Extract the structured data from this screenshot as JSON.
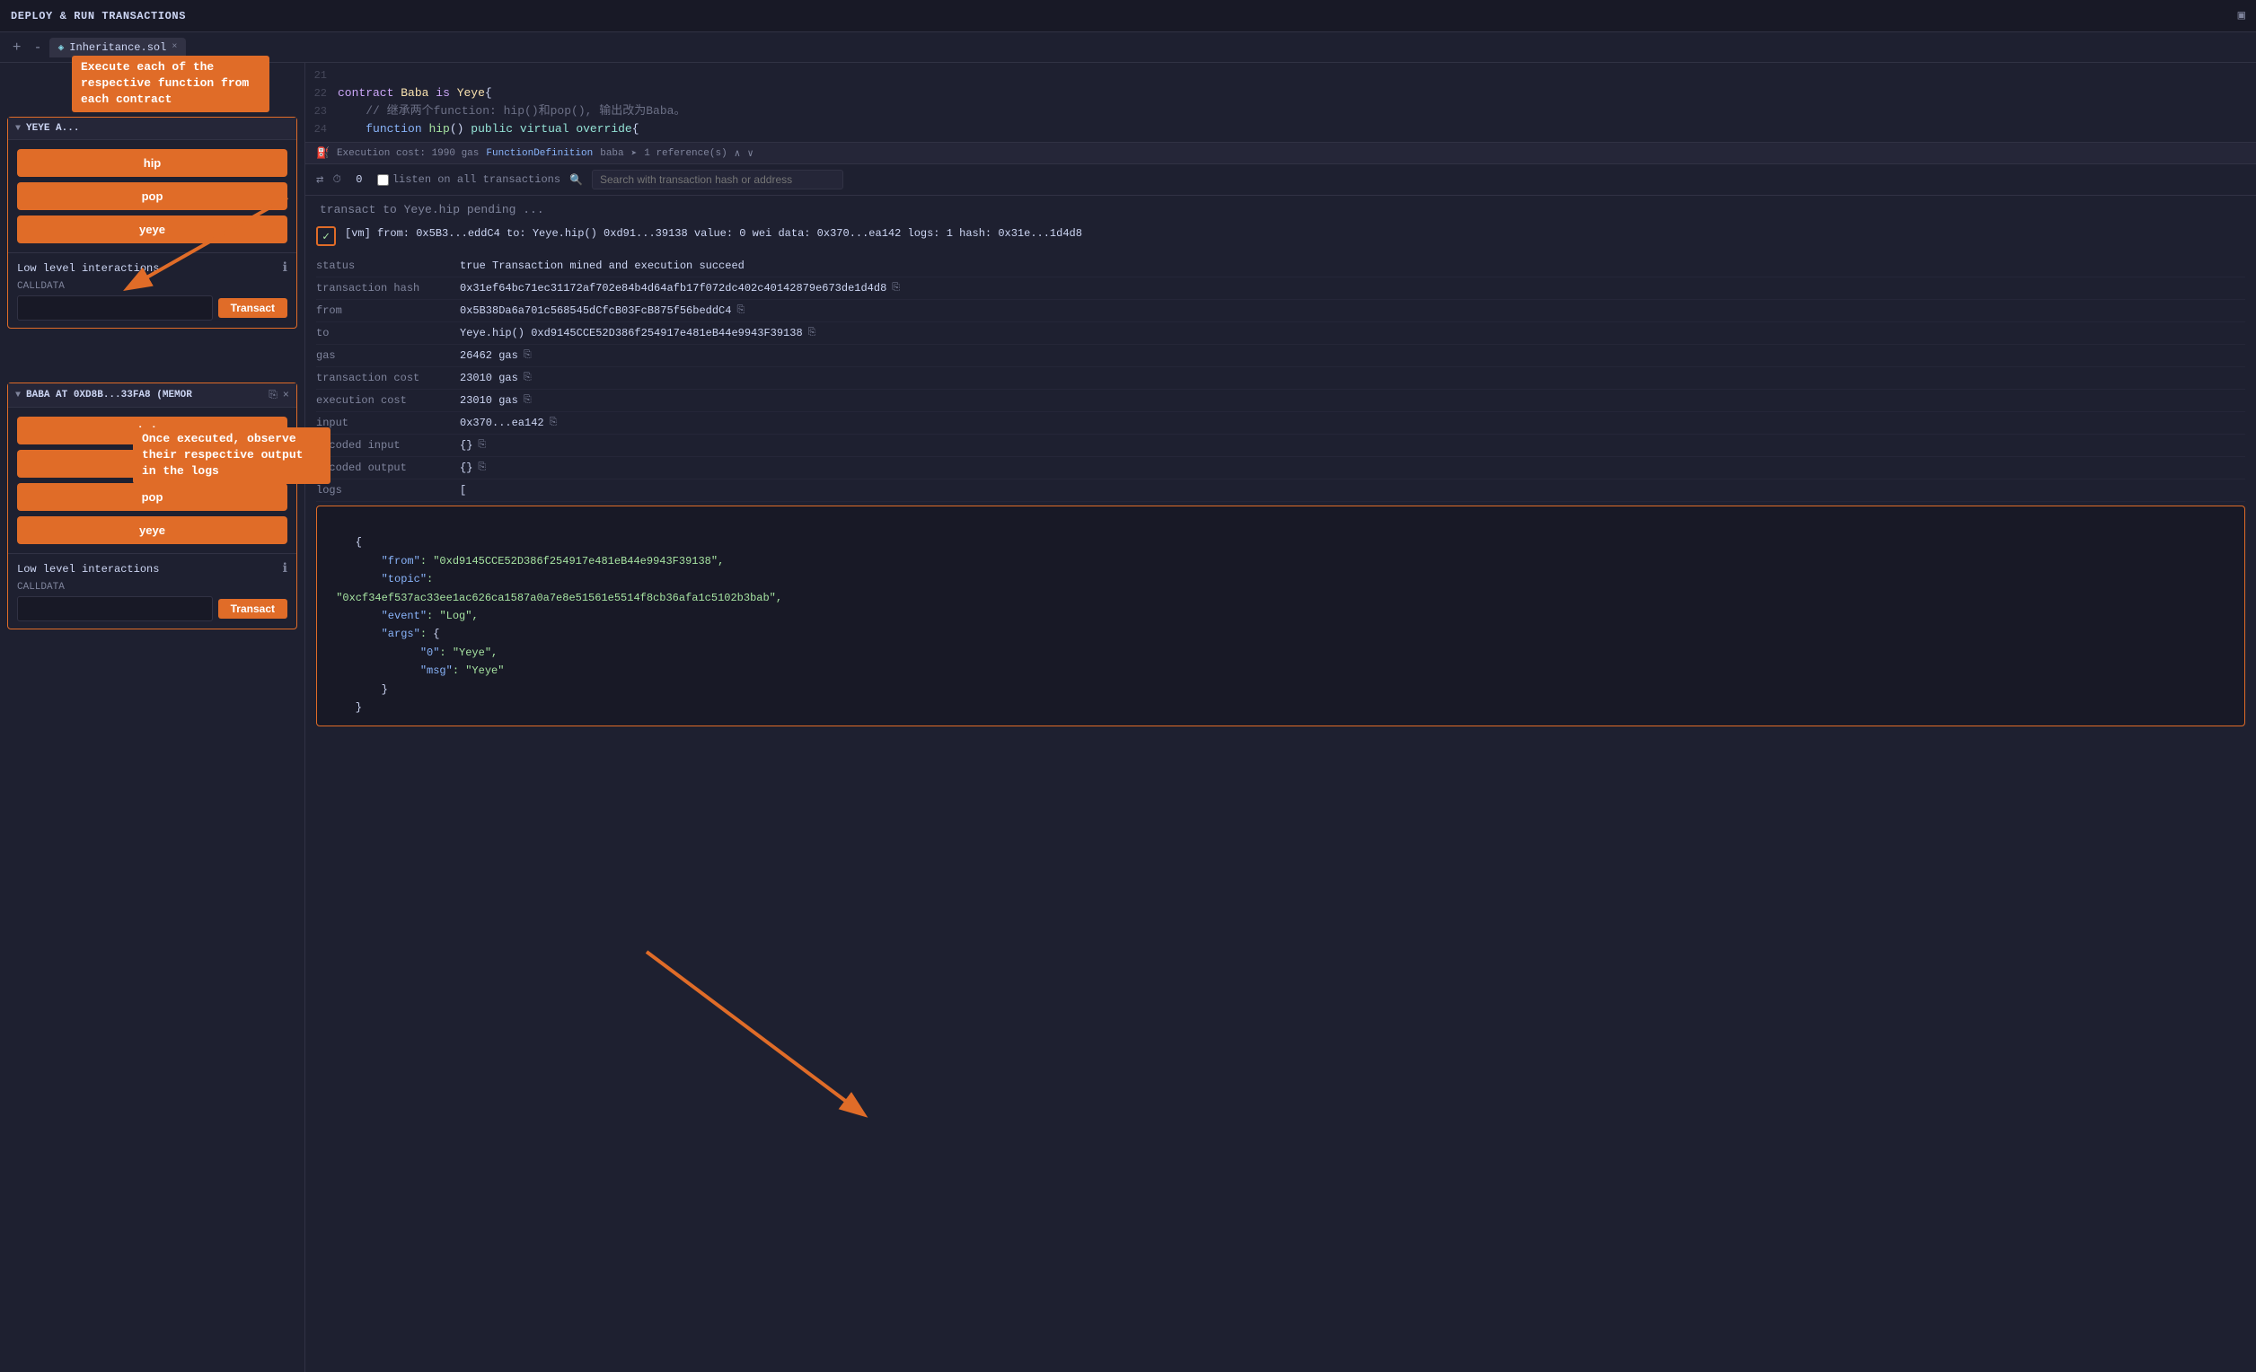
{
  "topbar": {
    "title": "DEPLOY & RUN TRANSACTIONS",
    "icon": "panel-icon"
  },
  "tabs": {
    "zoom_in": "+",
    "zoom_out": "-",
    "tab_label": "Inheritance.sol",
    "close": "×"
  },
  "code": {
    "lines": [
      {
        "num": "21",
        "content": ""
      },
      {
        "num": "22",
        "content": "contract Baba is Yeye{"
      },
      {
        "num": "23",
        "content": "    // 继承两个function: hip()和pop(), 输出改为Baba。"
      },
      {
        "num": "24",
        "content": "    function hip() public virtual override{"
      }
    ]
  },
  "exec_bar": {
    "icon": "⛽",
    "label": "Execution cost: 1990 gas",
    "func_type": "FunctionDefinition",
    "func_name": "baba",
    "refs": "1 reference(s)",
    "arrow_up": "∧",
    "arrow_down": "∨"
  },
  "tx_bar": {
    "counter": "0",
    "listen_label": "listen on all transactions",
    "search_placeholder": "Search with transaction hash or address"
  },
  "log_pending": "transact to Yeye.hip pending ...",
  "log_entry": {
    "summary": "[vm] from: 0x5B3...eddC4 to: Yeye.hip() 0xd91...39138 value: 0 wei data: 0x370...ea142 logs: 1 hash: 0x31e...1d4d8",
    "rows": [
      {
        "key": "status",
        "value": "true Transaction mined and execution succeed"
      },
      {
        "key": "transaction hash",
        "value": "0x31ef64bc71ec31172af702e84b4d64afb17f072dc402c40142879e673de1d4d8",
        "copy": true
      },
      {
        "key": "from",
        "value": "0x5B38Da6a701c568545dCfcB03FcB875f56beddC4",
        "copy": true
      },
      {
        "key": "to",
        "value": "Yeye.hip() 0xd9145CCE52D386f254917e481eB44e9943F39138",
        "copy": true
      },
      {
        "key": "gas",
        "value": "26462 gas",
        "copy": true
      },
      {
        "key": "transaction cost",
        "value": "23010 gas",
        "copy": true
      },
      {
        "key": "execution cost",
        "value": "23010 gas",
        "copy": true
      },
      {
        "key": "input",
        "value": "0x370...ea142",
        "copy": true
      },
      {
        "key": "decoded input",
        "value": "{}",
        "copy": true
      },
      {
        "key": "decoded output",
        "value": "{}",
        "copy": true
      },
      {
        "key": "logs",
        "value": "["
      }
    ],
    "logs_json": "    {\n        \"from\": \"0xd9145CCE52D386f254917e481eB44e9943F39138\",\n        \"topic\":\n \"0xcf34ef537ac33ee1ac626ca1587a0a7e8e51561e5514f8cb36afa1c5102b3bab\",\n        \"event\": \"Log\",\n        \"args\": {\n              \"0\": \"Yeye\",\n              \"msg\": \"Yeye\"\n        }\n    }"
  },
  "sidebar": {
    "yeye_section": {
      "header": "YEYE A...",
      "buttons": [
        "hip",
        "pop",
        "yeye"
      ]
    },
    "baba_section": {
      "header": "BABA AT 0XD8B...33FA8 (MEMOR",
      "buttons": [
        "baba",
        "hip",
        "pop",
        "yeye"
      ]
    },
    "low_level_label": "Low level interactions",
    "calldata_label": "CALLDATA",
    "transact_label": "Transact"
  },
  "annotations": {
    "one": "Execute each of the respective function from each contract",
    "two": "Once executed, observe their respective output in the logs"
  }
}
